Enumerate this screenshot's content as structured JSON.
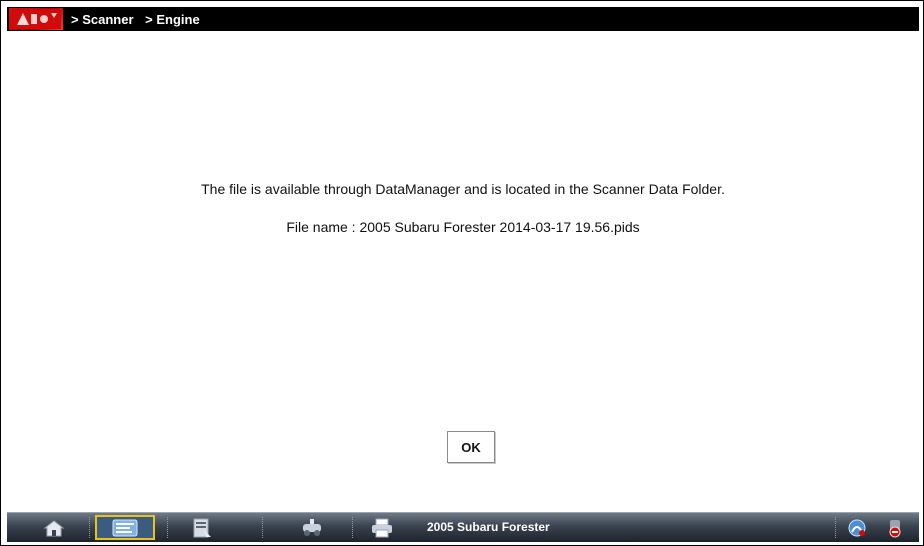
{
  "titlebar": {
    "logo_icon": "scanner-app-logo-icon",
    "breadcrumbs": [
      "> Scanner",
      "> Engine"
    ]
  },
  "dialog": {
    "message_line1": "The file is available through DataManager and is located in the Scanner Data Folder.",
    "message_line2": "File name : 2005 Subaru Forester 2014-03-17 19.56.pids",
    "ok_label": "OK"
  },
  "taskbar": {
    "buttons": [
      {
        "icon": "home-icon",
        "selected": false
      },
      {
        "icon": "scanner-icon",
        "selected": true
      },
      {
        "icon": "data-manager-icon",
        "selected": false
      },
      {
        "icon": "vehicle-lift-icon",
        "selected": false
      },
      {
        "icon": "print-icon",
        "selected": false
      }
    ],
    "vehicle_label": "2005 Subaru Forester",
    "right_icons": [
      "connection-status-icon",
      "vci-status-icon"
    ]
  },
  "colors": {
    "titlebar_bg": "#000000",
    "logo_red": "#e01010",
    "taskbar_top": "#6f7a87",
    "taskbar_bottom": "#1e242c",
    "selected_outline": "#e8c21b"
  }
}
